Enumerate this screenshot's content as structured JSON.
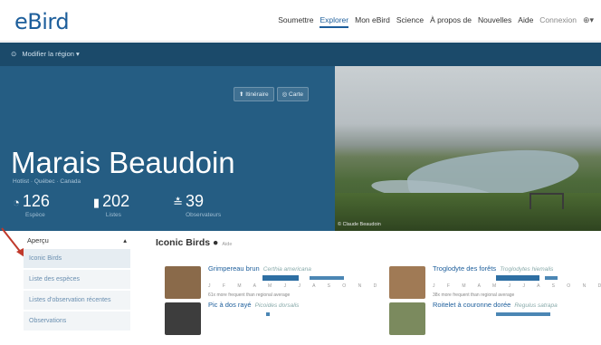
{
  "header": {
    "logo": "eBird",
    "nav": [
      "Soumettre",
      "Explorer",
      "Mon eBird",
      "Science",
      "À propos de",
      "Nouvelles",
      "Aide"
    ],
    "active_nav": "Explorer",
    "login": "Connexion"
  },
  "regionbar": {
    "label": "Modifier la région"
  },
  "hero": {
    "buttons": [
      "Itinéraire",
      "Carte"
    ],
    "title": "Marais Beaudoin",
    "subtitle": "Hotlist · Québec · Canada",
    "stats": [
      {
        "icon": "species-icon",
        "value": "126",
        "label": "Espèce"
      },
      {
        "icon": "checklist-icon",
        "value": "202",
        "label": "Listes"
      },
      {
        "icon": "observer-icon",
        "value": "39",
        "label": "Observateurs"
      }
    ],
    "photo_credit": "© Claude Beaudoin"
  },
  "sidebar": {
    "heading": "Aperçu",
    "items": [
      "Iconic Birds",
      "Liste des espèces",
      "Listes d'observation récentes",
      "Observations"
    ]
  },
  "main": {
    "title": "Iconic Birds",
    "title_note": "Aide",
    "birds": [
      {
        "name": "Grimpereau brun",
        "sci": "Certhia americana",
        "note": "61x more frequent than regional average",
        "color": "#8a6a4a"
      },
      {
        "name": "Troglodyte des forêts",
        "sci": "Troglodytes hiemalis",
        "note": "38x more frequent than regional average",
        "color": "#a07a55"
      },
      {
        "name": "Pic à dos rayé",
        "sci": "Picoides dorsalis",
        "note": "",
        "color": "#3d3d3d"
      },
      {
        "name": "Roitelet à couronne dorée",
        "sci": "Regulus satrapa",
        "note": "",
        "color": "#7b8a5e"
      }
    ],
    "months": "J F M A M J J A S O N D"
  },
  "colors": {
    "accent": "#1d5e9b",
    "hero": "#23597e",
    "logo_green": "#2a7f2a"
  }
}
